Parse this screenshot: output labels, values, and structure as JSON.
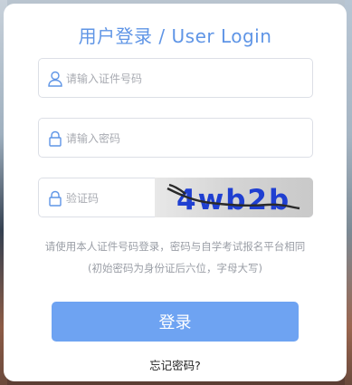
{
  "title": "用户登录 / User Login",
  "fields": {
    "id_number": {
      "placeholder": "请输入证件号码",
      "icon": "user-icon"
    },
    "password": {
      "placeholder": "请输入密码",
      "icon": "lock-icon"
    },
    "captcha": {
      "placeholder": "验证码",
      "icon": "lock-icon",
      "captcha_text": "4wb2b"
    }
  },
  "hints": {
    "line1": "请使用本人证件号码登录，密码与自学考试报名平台相同",
    "line2": "(初始密码为身份证后六位，字母大写)"
  },
  "login_button": "登录",
  "forgot_password": "忘记密码?",
  "colors": {
    "accent": "#5f95e6",
    "button": "#6ea3f2",
    "captcha_text": "#1f3fd1"
  }
}
